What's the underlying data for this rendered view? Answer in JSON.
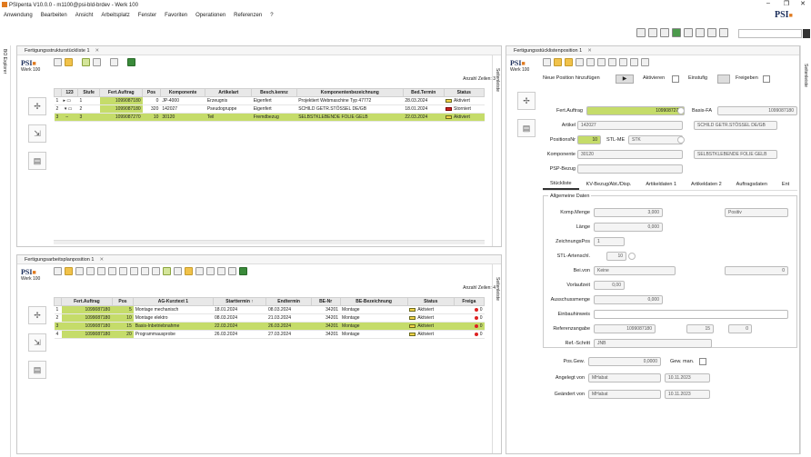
{
  "window": {
    "title": "PSIpenta V10.0.0 - m1100@psi-bld-brdev - Werk 100",
    "controls": [
      "–",
      "❐",
      "✕"
    ]
  },
  "menu": [
    "Anwendung",
    "Bearbeiten",
    "Ansicht",
    "Arbeitsplatz",
    "Fenster",
    "Favoriten",
    "Operationen",
    "Referenzen",
    "?"
  ],
  "brand": {
    "name": "PSI",
    "werk": "Werk 100",
    "accent": "#c5dc6a"
  },
  "left_strip": {
    "label": "BO Explorer"
  },
  "side_label": "Seitenleiste",
  "panel1": {
    "tab": "Fertigungsstrukturstückliste 1",
    "anzahl": "Anzahl Zeilen: 3",
    "tree_icon": "123",
    "columns": [
      "Stufe",
      "Fert.Auftrag",
      "Pos",
      "Komponente",
      "Artikelart",
      "Besch.kennz",
      "Komponentenbezeichnung",
      "Bed.Termin",
      "Status"
    ],
    "rows": [
      {
        "n": "1",
        "stufe": "1",
        "auftrag": "1099087180",
        "pos": "0",
        "komp": "JP-4000",
        "art": "Erzeugnis",
        "besch": "Eigenfert",
        "bez": "Projektiert Webmaschine Typ 47772",
        "term": "28.03.2024",
        "status": "Aktiviert",
        "st": "ok"
      },
      {
        "n": "2",
        "stufe": "2",
        "auftrag": "1099087180",
        "pos": "320",
        "komp": "142027",
        "art": "Pseudogruppe",
        "besch": "Eigenfert",
        "bez": "SCHILD GETR.STÖSSEL       DE/GB",
        "term": "18.01.2024",
        "status": "Storniert",
        "st": "red"
      },
      {
        "n": "3",
        "stufe": "3",
        "auftrag": "1099087270",
        "pos": "10",
        "komp": "30120",
        "art": "Teil",
        "besch": "Fremdbezug",
        "bez": "SELBSTKLEBENDE FOLIE GELB",
        "term": "22.03.2024",
        "status": "Aktiviert",
        "st": "ok"
      }
    ]
  },
  "panel2": {
    "tab": "Fertigungsarbeitsplanposition 1",
    "anzahl": "Anzahl Zeilen: 4",
    "columns": [
      "Fert.Auftrag",
      "Pos",
      "AG-Kurztext 1",
      "Starttermin ↑",
      "Endtermin",
      "BE-Nr",
      "BE-Bezeichnung",
      "Status",
      "Freiga"
    ],
    "rows": [
      {
        "n": "1",
        "auftrag": "1099087180",
        "pos": "5",
        "text": "Montage mechanisch",
        "start": "18.01.2024",
        "end": "08.03.2024",
        "be": "34201",
        "bez": "Montage",
        "status": "Aktiviert",
        "fr": "0"
      },
      {
        "n": "2",
        "auftrag": "1099087180",
        "pos": "10",
        "text": "Montage elektro",
        "start": "08.03.2024",
        "end": "21.03.2024",
        "be": "34201",
        "bez": "Montage",
        "status": "Aktiviert",
        "fr": "0"
      },
      {
        "n": "3",
        "auftrag": "1099087180",
        "pos": "15",
        "text": "Basis-Inbetriebnahme",
        "start": "22.03.2024",
        "end": "26.03.2024",
        "be": "34201",
        "bez": "Montage",
        "status": "Aktiviert",
        "fr": "0"
      },
      {
        "n": "4",
        "auftrag": "1099087180",
        "pos": "20",
        "text": "Programmausprobe",
        "start": "26.03.2024",
        "end": "27.03.2024",
        "be": "34201",
        "bez": "Montage",
        "status": "Aktiviert",
        "fr": "0"
      }
    ]
  },
  "panel3": {
    "tab": "Fertigungsstücklistenposition 1",
    "neue_position": "Neue Position hinzufügen",
    "aktivieren": "Aktivieren",
    "einstufig": "Einstufig",
    "freigeben": "Freigeben",
    "labels": {
      "fert": "Fert.Auftrag",
      "basis": "Basis-FA",
      "artikel": "Artikel",
      "posnr": "PositionsNr",
      "stlme": "STL-ME",
      "komp": "Komponente",
      "psp": "PSP-Bezug"
    },
    "values": {
      "fert": "1099087270",
      "basis": "1099087180",
      "artikel": "142027",
      "artikel_bez": "SCHILD GETR.STÖSSEL       DE/GB",
      "posnr": "10",
      "stlme": "STK",
      "komp": "30120",
      "komp_bez": "SELBSTKLEBENDE FOLIE GELB"
    },
    "detail_tabs": [
      "Stückliste",
      "KV-Bezug/Abt./Disp.",
      "Artikeldaten 1",
      "Artikeldaten 2",
      "Auftragsdaten",
      "Ent"
    ],
    "group": "Allgemeine Daten",
    "f": {
      "kompmenge_l": "Komp.Menge",
      "kompmenge": "3,000",
      "positiv": "Positiv",
      "laenge_l": "Länge",
      "laenge": "0,000",
      "zpos_l": "ZeichnungsPos",
      "zpos": "1",
      "stlart_l": "STL-Artenschl.",
      "stlart": "10",
      "beivon_l": "Bei.von",
      "beivon": "Keine",
      "beivon_r": "0",
      "vorlauf_l": "Vorlaufzeit",
      "vorlauf": "0,00",
      "aussch_l": "Ausschussmenge",
      "aussch": "0,000",
      "einbau_l": "Einbauhinweis",
      "ref_l": "Referenzangabe",
      "ref1": "1099087180",
      "ref2": "15",
      "ref3": "0",
      "refschritt_l": "Ref.-Schritt",
      "refschritt": "JNB",
      "posgew_l": "Pos.Gew.",
      "posgew": "0,0000",
      "gewman_l": "Gew. man.",
      "angelegt_l": "Angelegt von",
      "angelegt": "MHabat",
      "angelegt_d": "10.11.2023",
      "geaendert_l": "Geändert von",
      "geaendert": "MHabat",
      "geaendert_d": "10.11.2023"
    }
  }
}
